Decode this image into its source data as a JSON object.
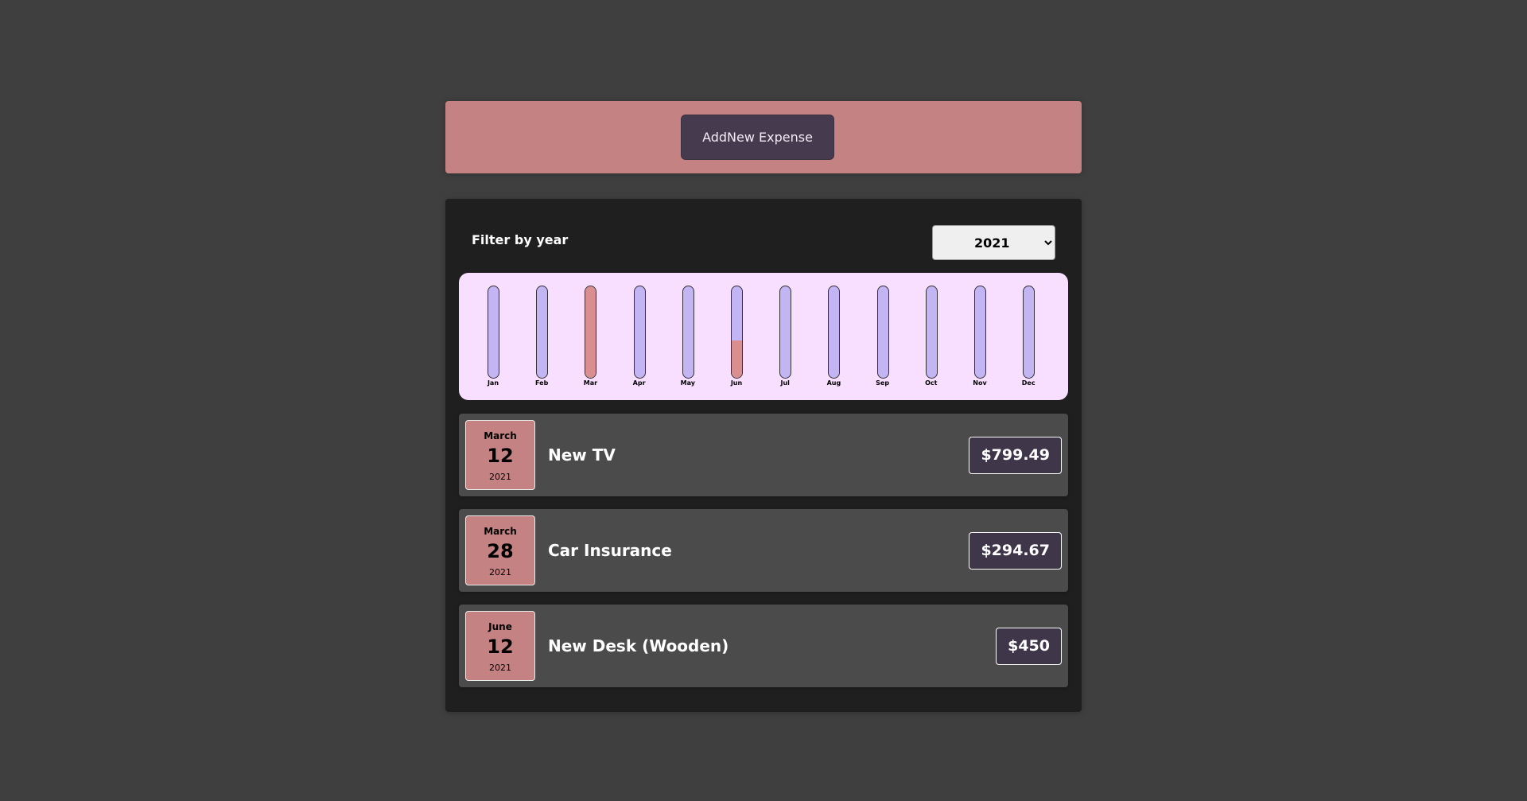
{
  "new_expense": {
    "button_label": "AddNew Expense"
  },
  "filter": {
    "label": "Filter by year",
    "selected_year": "2021",
    "options": [
      "2021"
    ]
  },
  "chart_data": {
    "type": "bar",
    "categories": [
      "Jan",
      "Feb",
      "Mar",
      "Apr",
      "May",
      "Jun",
      "Jul",
      "Aug",
      "Sep",
      "Oct",
      "Nov",
      "Dec"
    ],
    "values": [
      0,
      0,
      1094.16,
      0,
      0,
      450,
      0,
      0,
      0,
      0,
      0,
      0
    ],
    "max_value": 1094.16,
    "colors": {
      "empty": "#c3b4f3",
      "fill": "#d98f8f",
      "background": "#f8dfff"
    }
  },
  "expenses": [
    {
      "month": "March",
      "day": "12",
      "year": "2021",
      "title": "New TV",
      "amount": "$799.49"
    },
    {
      "month": "March",
      "day": "28",
      "year": "2021",
      "title": "Car Insurance",
      "amount": "$294.67"
    },
    {
      "month": "June",
      "day": "12",
      "year": "2021",
      "title": "New Desk (Wooden)",
      "amount": "$450"
    }
  ]
}
